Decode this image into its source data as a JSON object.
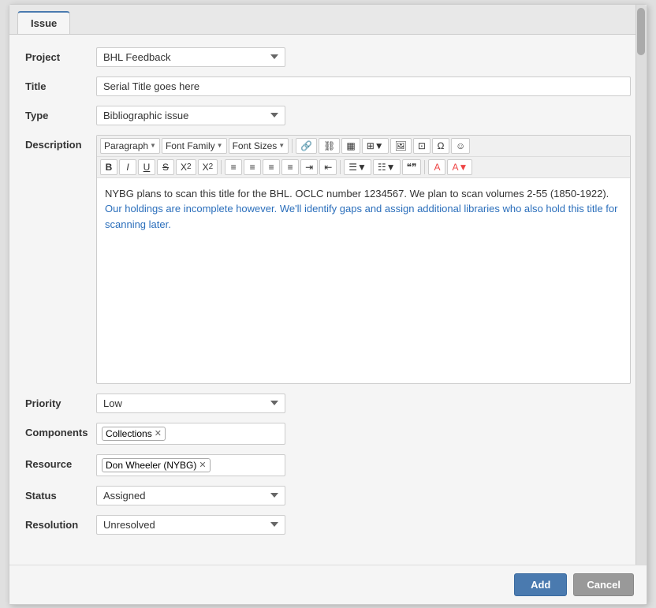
{
  "dialog": {
    "tab_label": "Issue"
  },
  "form": {
    "project_label": "Project",
    "project_value": "BHL Feedback",
    "title_label": "Title",
    "title_value": "Serial Title goes here",
    "type_label": "Type",
    "type_value": "Bibliographic issue",
    "description_label": "Description",
    "priority_label": "Priority",
    "priority_value": "Low",
    "components_label": "Components",
    "components_tag": "Collections",
    "resource_label": "Resource",
    "resource_tag": "Don Wheeler (NYBG)",
    "status_label": "Status",
    "status_value": "Assigned",
    "resolution_label": "Resolution",
    "resolution_value": "Unresolved"
  },
  "toolbar": {
    "paragraph_label": "Paragraph",
    "font_family_label": "Font Family",
    "font_sizes_label": "Font Sizes",
    "bold_label": "B",
    "italic_label": "I",
    "underline_label": "U",
    "strikethrough_label": "S",
    "subscript_label": "X₂",
    "superscript_label": "X²"
  },
  "editor_content": {
    "text": "NYBG plans to scan this title for the BHL. OCLC number 1234567. We plan to scan volumes 2-55 (1850-1922). Our holdings are incomplete however. We'll identify gaps and assign additional libraries who also hold this title for scanning later."
  },
  "buttons": {
    "add_label": "Add",
    "cancel_label": "Cancel"
  }
}
